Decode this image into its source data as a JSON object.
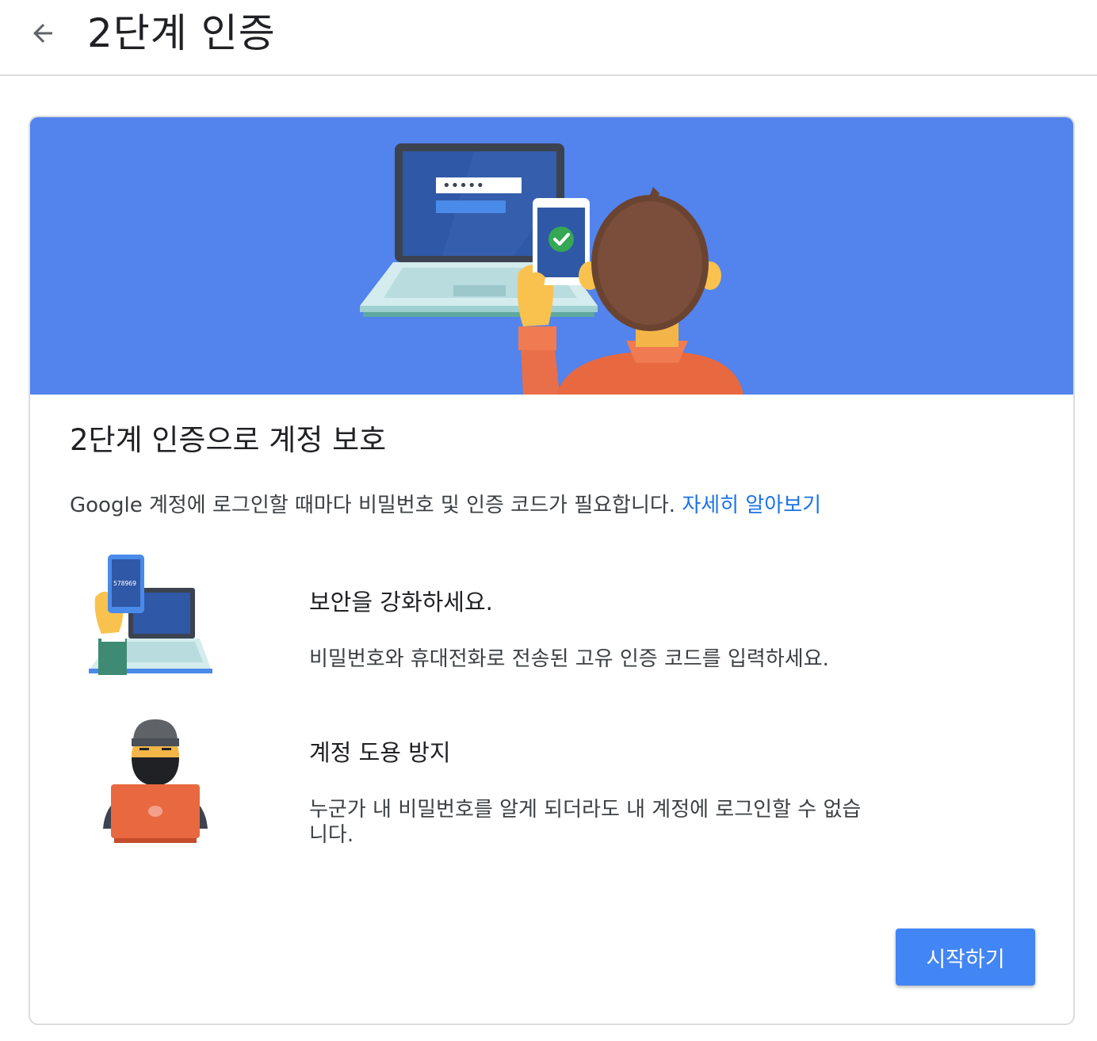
{
  "header": {
    "back_icon": "arrow-back-icon",
    "title": "2단계 인증"
  },
  "hero": {
    "illustration": "laptop-phone-verification-illustration",
    "password_mask": "•••••"
  },
  "card": {
    "heading": "2단계 인증으로 계정 보호",
    "description": "Google 계정에 로그인할 때마다 비밀번호 및 인증 코드가 필요합니다.",
    "learn_more": "자세히 알아보기",
    "features": [
      {
        "icon": "phone-code-laptop-illustration",
        "code": "578969",
        "title": "보안을 강화하세요.",
        "text": "비밀번호와 휴대전화로 전송된 고유 인증 코드를 입력하세요."
      },
      {
        "icon": "hacker-laptop-illustration",
        "title": "계정 도용 방지",
        "text": "누군가 내 비밀번호를 알게 되더라도 내 계정에 로그인할 수 없습니다."
      }
    ],
    "start_button": "시작하기"
  },
  "colors": {
    "hero_bg": "#5383ec",
    "link": "#1a73e8",
    "button": "#4285f4"
  }
}
